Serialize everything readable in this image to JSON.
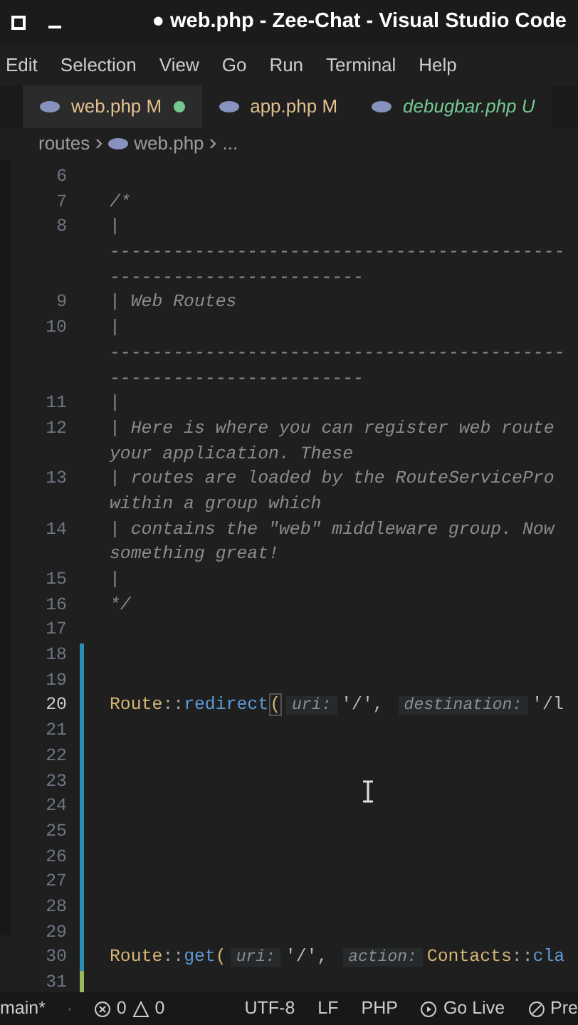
{
  "window": {
    "title": "● web.php - Zee-Chat - Visual Studio Code"
  },
  "menu": [
    "Edit",
    "Selection",
    "View",
    "Go",
    "Run",
    "Terminal",
    "Help"
  ],
  "tabs": [
    {
      "label": "web.php",
      "badge": "M",
      "untracked": false,
      "dirty": true,
      "selected": true
    },
    {
      "label": "app.php",
      "badge": "M",
      "untracked": false,
      "dirty": false,
      "selected": false
    },
    {
      "label": "debugbar.php",
      "badge": "U",
      "untracked": true,
      "dirty": false,
      "selected": false
    }
  ],
  "breadcrumb": [
    "routes",
    "web.php",
    "..."
  ],
  "lines": [
    {
      "number": "6",
      "current": false,
      "added": false,
      "modified": false,
      "rows": [
        []
      ]
    },
    {
      "number": "7",
      "current": false,
      "added": false,
      "modified": false,
      "rows": [
        [
          {
            "kind": "comment",
            "text": "/*"
          }
        ]
      ]
    },
    {
      "number": "8",
      "current": false,
      "added": false,
      "modified": false,
      "rows": [
        [
          {
            "kind": "comment",
            "text": "|"
          }
        ],
        [
          {
            "kind": "comment",
            "text": "-------------------------------------------"
          }
        ],
        [
          {
            "kind": "comment",
            "text": "------------------------"
          }
        ]
      ]
    },
    {
      "number": "9",
      "current": false,
      "added": false,
      "modified": false,
      "rows": [
        [
          {
            "kind": "comment",
            "text": "| Web Routes"
          }
        ]
      ]
    },
    {
      "number": "10",
      "current": false,
      "added": false,
      "modified": false,
      "rows": [
        [
          {
            "kind": "comment",
            "text": "|"
          }
        ],
        [
          {
            "kind": "comment",
            "text": "-------------------------------------------"
          }
        ],
        [
          {
            "kind": "comment",
            "text": "------------------------"
          }
        ]
      ]
    },
    {
      "number": "11",
      "current": false,
      "added": false,
      "modified": false,
      "rows": [
        [
          {
            "kind": "comment",
            "text": "|"
          }
        ]
      ]
    },
    {
      "number": "12",
      "current": false,
      "added": false,
      "modified": false,
      "rows": [
        [
          {
            "kind": "comment",
            "text": "| Here is where you can register web route"
          }
        ],
        [
          {
            "kind": "comment",
            "text": "your application. These"
          }
        ]
      ]
    },
    {
      "number": "13",
      "current": false,
      "added": false,
      "modified": false,
      "rows": [
        [
          {
            "kind": "comment",
            "text": "| routes are loaded by the RouteServicePro"
          }
        ],
        [
          {
            "kind": "comment",
            "text": "within a group which"
          }
        ]
      ]
    },
    {
      "number": "14",
      "current": false,
      "added": false,
      "modified": false,
      "rows": [
        [
          {
            "kind": "comment",
            "text": "| contains the \"web\" middleware group. Now"
          }
        ],
        [
          {
            "kind": "comment",
            "text": "something great!"
          }
        ]
      ]
    },
    {
      "number": "15",
      "current": false,
      "added": false,
      "modified": false,
      "rows": [
        [
          {
            "kind": "comment",
            "text": "|"
          }
        ]
      ]
    },
    {
      "number": "16",
      "current": false,
      "added": false,
      "modified": false,
      "rows": [
        [
          {
            "kind": "comment",
            "text": "*/"
          }
        ]
      ]
    },
    {
      "number": "17",
      "current": false,
      "added": false,
      "modified": false,
      "rows": [
        []
      ]
    },
    {
      "number": "18",
      "current": false,
      "added": true,
      "modified": false,
      "rows": [
        []
      ]
    },
    {
      "number": "19",
      "current": false,
      "added": true,
      "modified": false,
      "rows": [
        []
      ]
    },
    {
      "number": "20",
      "current": true,
      "added": true,
      "modified": false,
      "rows": [
        [
          {
            "kind": "class",
            "text": "Route"
          },
          {
            "kind": "op",
            "text": "::"
          },
          {
            "kind": "fn",
            "text": "redirect"
          },
          {
            "kind": "bracket",
            "text": "("
          },
          {
            "kind": "hint",
            "text": "uri:"
          },
          {
            "kind": "str",
            "text": "'/',"
          },
          {
            "kind": "hint",
            "text": "destination:"
          },
          {
            "kind": "str",
            "text": "'/l"
          }
        ]
      ]
    },
    {
      "number": "21",
      "current": false,
      "added": true,
      "modified": false,
      "rows": [
        []
      ]
    },
    {
      "number": "22",
      "current": false,
      "added": true,
      "modified": false,
      "rows": [
        []
      ]
    },
    {
      "number": "23",
      "current": false,
      "added": true,
      "modified": false,
      "rows": [
        []
      ]
    },
    {
      "number": "24",
      "current": false,
      "added": true,
      "modified": false,
      "rows": [
        []
      ]
    },
    {
      "number": "25",
      "current": false,
      "added": true,
      "modified": false,
      "rows": [
        []
      ]
    },
    {
      "number": "26",
      "current": false,
      "added": true,
      "modified": false,
      "rows": [
        []
      ]
    },
    {
      "number": "27",
      "current": false,
      "added": true,
      "modified": false,
      "rows": [
        []
      ]
    },
    {
      "number": "28",
      "current": false,
      "added": true,
      "modified": false,
      "rows": [
        []
      ]
    },
    {
      "number": "29",
      "current": false,
      "added": true,
      "modified": false,
      "rows": [
        []
      ]
    },
    {
      "number": "30",
      "current": false,
      "added": true,
      "modified": false,
      "rows": [
        [
          {
            "kind": "class",
            "text": "Route"
          },
          {
            "kind": "op",
            "text": "::"
          },
          {
            "kind": "fn",
            "text": "get"
          },
          {
            "kind": "punct",
            "text": "("
          },
          {
            "kind": "hint",
            "text": "uri:"
          },
          {
            "kind": "str",
            "text": "'/',"
          },
          {
            "kind": "hint",
            "text": "action:"
          },
          {
            "kind": "class",
            "text": "Contacts"
          },
          {
            "kind": "op",
            "text": "::"
          },
          {
            "kind": "fn",
            "text": "cla"
          }
        ]
      ]
    },
    {
      "number": "31",
      "current": false,
      "added": false,
      "modified": true,
      "rows": [
        []
      ]
    }
  ],
  "status_bar": {
    "branch": "main*",
    "errors": "0",
    "warnings": "0",
    "items": [
      "UTF-8",
      "LF",
      "PHP"
    ],
    "go_live": "Go Live",
    "prettier": "Pre"
  }
}
